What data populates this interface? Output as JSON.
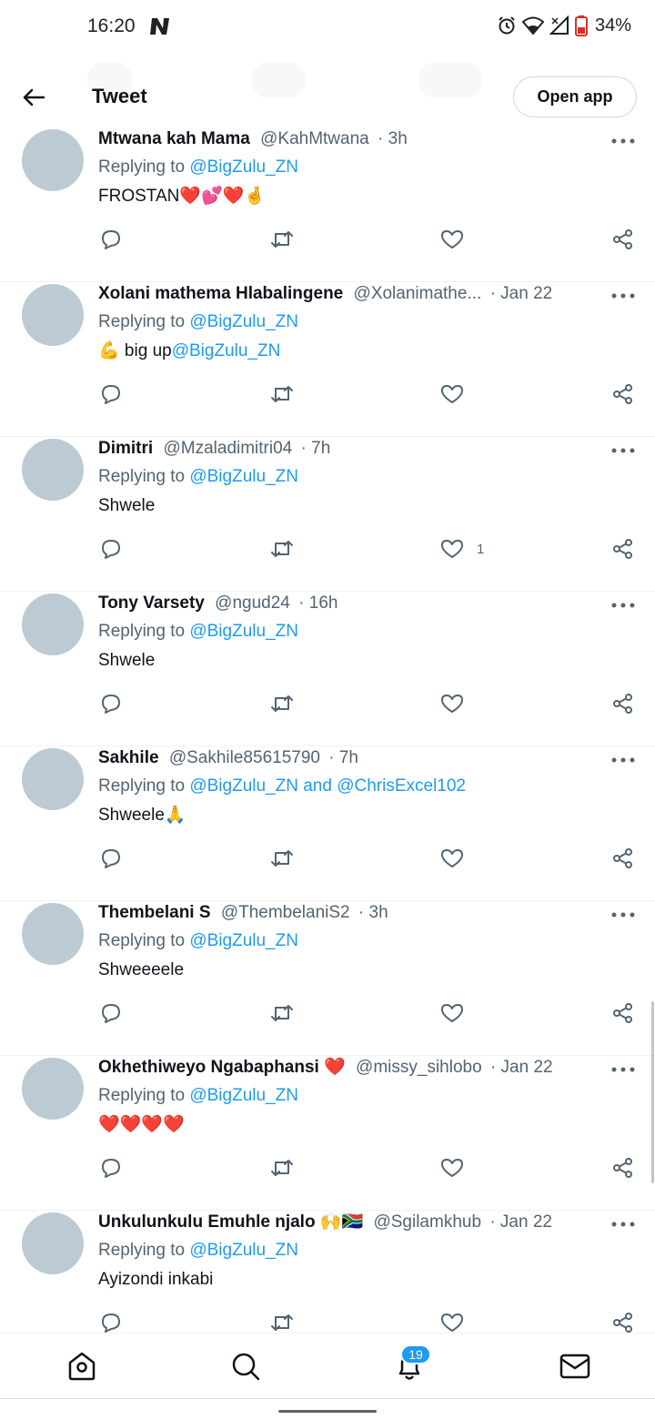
{
  "status_bar": {
    "time": "16:20",
    "battery": "34%"
  },
  "header": {
    "title": "Tweet",
    "open_app": "Open app"
  },
  "tweets": [
    {
      "name": "Mtwana kah Mama",
      "handle": "@KahMtwana",
      "time": "· 3h",
      "replying_prefix": "Replying to ",
      "replying_to": "@BigZulu_ZN",
      "replying_extra": "",
      "text": "FROSTAN",
      "text_link": "",
      "emoji": "❤️💕❤️🤞",
      "likes": ""
    },
    {
      "name": "Xolani mathema Hlabalingene",
      "handle": "@Xolanimathe...",
      "time": " · Jan 22",
      "replying_prefix": "Replying to ",
      "replying_to": "@BigZulu_ZN",
      "replying_extra": "",
      "text": "💪 big up ",
      "text_link": "@BigZulu_ZN",
      "emoji": "",
      "likes": ""
    },
    {
      "name": "Dimitri",
      "handle": "@Mzaladimitri04",
      "time": "· 7h",
      "replying_prefix": "Replying to ",
      "replying_to": "@BigZulu_ZN",
      "replying_extra": "",
      "text": "Shwele",
      "text_link": "",
      "emoji": "",
      "likes": "1"
    },
    {
      "name": "Tony Varsety",
      "handle": "@ngud24",
      "time": "· 16h",
      "replying_prefix": "Replying to ",
      "replying_to": "@BigZulu_ZN",
      "replying_extra": "",
      "text": "Shwele",
      "text_link": "",
      "emoji": "",
      "likes": ""
    },
    {
      "name": "Sakhile",
      "handle": "@Sakhile85615790",
      "time": "· 7h",
      "replying_prefix": "Replying to ",
      "replying_to": "@BigZulu_ZN",
      "replying_extra": " and @ChrisExcel102",
      "text": "Shweele",
      "text_link": "",
      "emoji": "🙏",
      "likes": ""
    },
    {
      "name": "Thembelani S",
      "handle": "@ThembelaniS2",
      "time": "· 3h",
      "replying_prefix": "Replying to ",
      "replying_to": "@BigZulu_ZN",
      "replying_extra": "",
      "text": "Shweeeele",
      "text_link": "",
      "emoji": "",
      "likes": ""
    },
    {
      "name": "Okhethiweyo Ngabaphansi ❤️",
      "handle": "@missy_sihlobo",
      "time": "· Jan 22",
      "replying_prefix": "Replying to ",
      "replying_to": "@BigZulu_ZN",
      "replying_extra": "",
      "text": "",
      "text_link": "",
      "emoji": "❤️❤️❤️❤️",
      "likes": ""
    },
    {
      "name": "Unkulunkulu Emuhle njalo 🙌🇿🇦",
      "handle": "@Sgilamkhub",
      "time": "· Jan 22",
      "replying_prefix": "Replying to ",
      "replying_to": "@BigZulu_ZN",
      "replying_extra": "",
      "text": "Ayizondi inkabi",
      "text_link": "",
      "emoji": "",
      "likes": ""
    }
  ],
  "bottom_nav": {
    "notifications_badge": "19"
  },
  "colors": {
    "link": "#1d9bf0",
    "secondary_text": "#536471",
    "avatar": "#bccbd3",
    "divider": "#eff3f4"
  }
}
